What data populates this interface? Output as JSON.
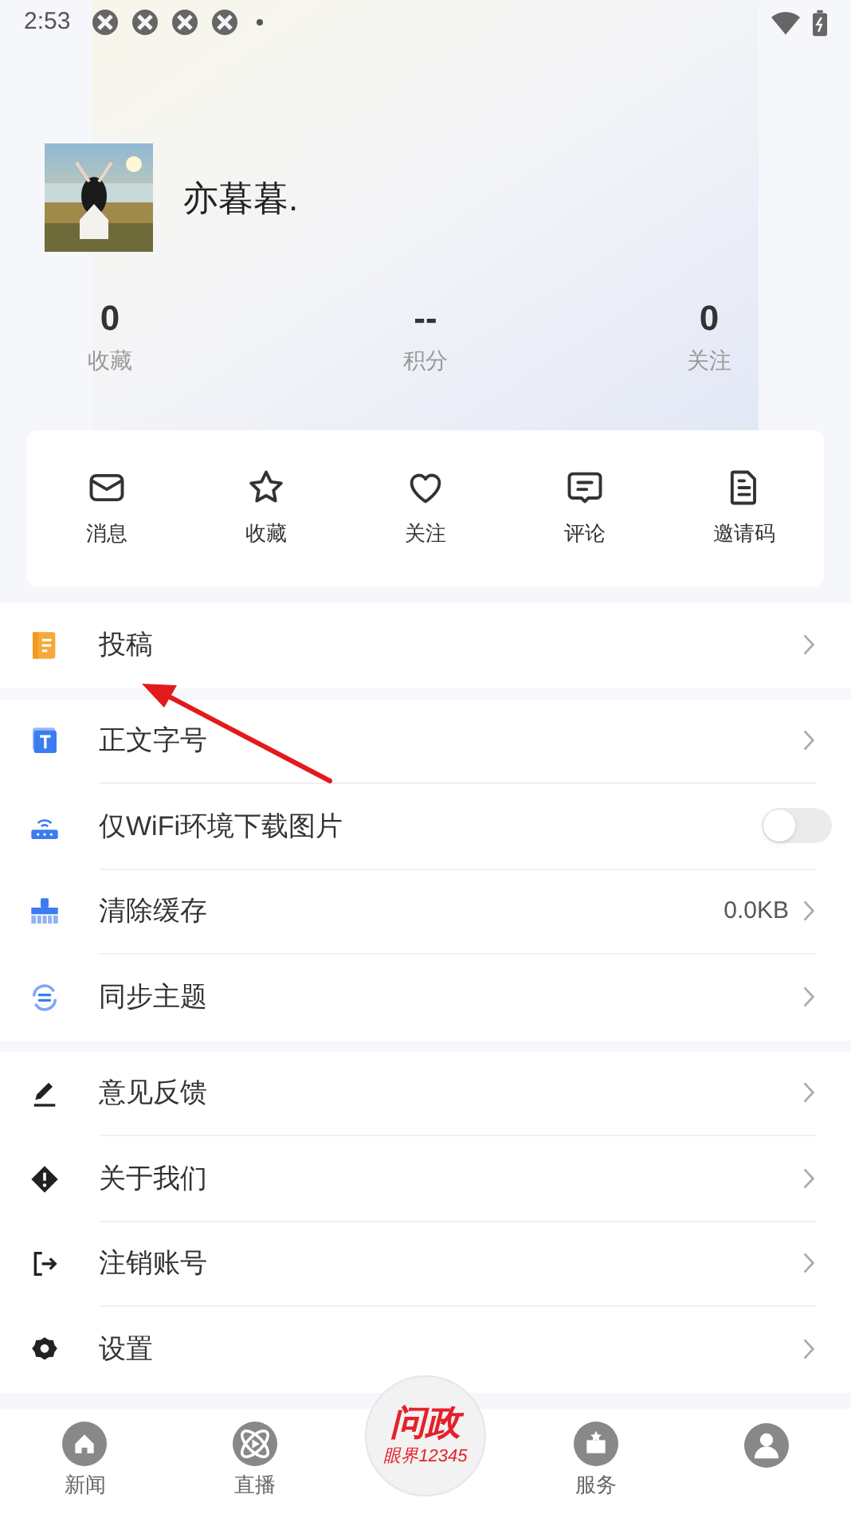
{
  "status_bar": {
    "time": "2:53"
  },
  "profile": {
    "name": "亦暮暮."
  },
  "stats": [
    {
      "value": "0",
      "label": "收藏"
    },
    {
      "value": "--",
      "label": "积分"
    },
    {
      "value": "0",
      "label": "关注"
    }
  ],
  "quick_actions": [
    {
      "kind": "mail",
      "label": "消息"
    },
    {
      "kind": "star",
      "label": "收藏"
    },
    {
      "kind": "heart",
      "label": "关注"
    },
    {
      "kind": "comment",
      "label": "评论"
    },
    {
      "kind": "doc",
      "label": "邀请码"
    }
  ],
  "menu_groups": [
    [
      {
        "kind": "submit",
        "label": "投稿"
      }
    ],
    [
      {
        "kind": "font",
        "label": "正文字号"
      },
      {
        "kind": "wifi",
        "label": "仅WiFi环境下载图片",
        "on": false
      },
      {
        "kind": "clean",
        "label": "清除缓存",
        "value": "0.0KB"
      },
      {
        "kind": "sync",
        "label": "同步主题"
      }
    ],
    [
      {
        "kind": "pen",
        "label": "意见反馈"
      },
      {
        "kind": "info",
        "label": "关于我们"
      },
      {
        "kind": "logout",
        "label": "注销账号"
      },
      {
        "kind": "gear",
        "label": "设置"
      }
    ]
  ],
  "bottom_nav": [
    {
      "kind": "home",
      "label": "新闻"
    },
    {
      "kind": "live",
      "label": "直播"
    },
    {
      "kind": "center",
      "title": "问政",
      "subtitle": "眼界12345"
    },
    {
      "kind": "service",
      "label": "服务"
    },
    {
      "kind": "user"
    }
  ]
}
